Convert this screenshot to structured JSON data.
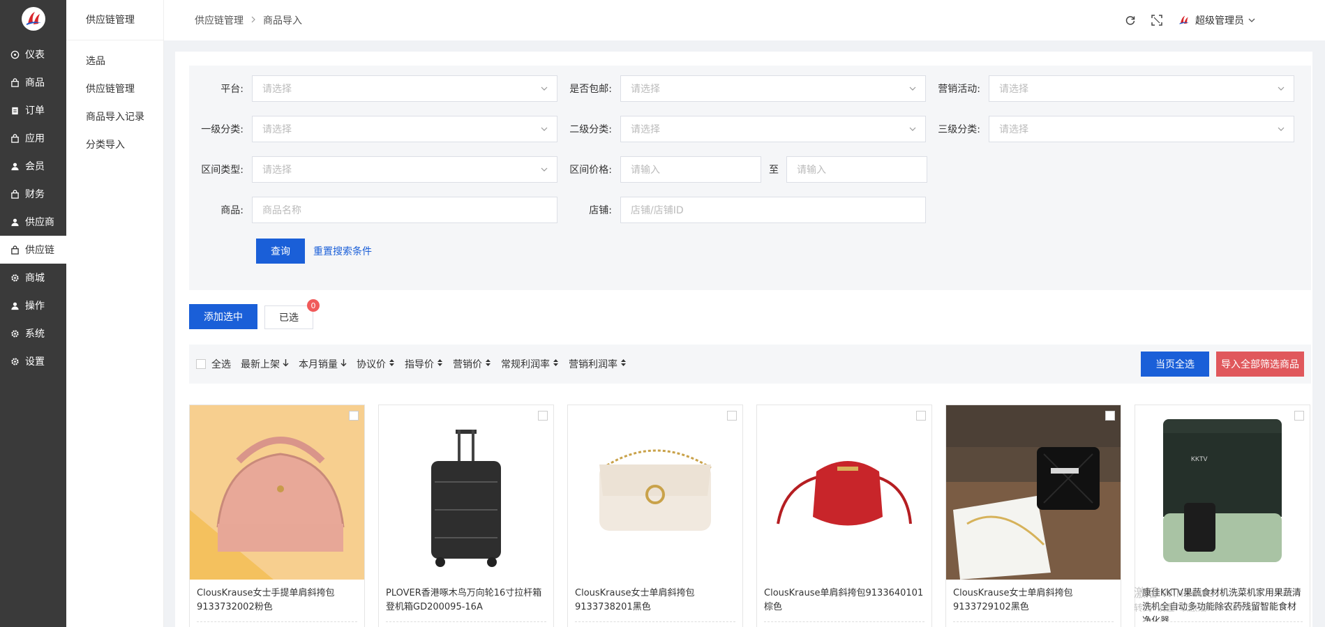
{
  "sidebar": {
    "items": [
      {
        "label": "仪表",
        "icon": "dashboard-icon"
      },
      {
        "label": "商品",
        "icon": "bag-icon"
      },
      {
        "label": "订单",
        "icon": "clipboard-icon"
      },
      {
        "label": "应用",
        "icon": "bag-icon"
      },
      {
        "label": "会员",
        "icon": "user-icon"
      },
      {
        "label": "财务",
        "icon": "bag-icon"
      },
      {
        "label": "供应商",
        "icon": "user-icon"
      },
      {
        "label": "供应链",
        "icon": "bag-icon"
      },
      {
        "label": "商城",
        "icon": "gear-icon"
      },
      {
        "label": "操作",
        "icon": "user-icon"
      },
      {
        "label": "系统",
        "icon": "gear-icon"
      },
      {
        "label": "设置",
        "icon": "gear-icon"
      }
    ],
    "active_index": 7
  },
  "subbar": {
    "title": "供应链管理",
    "items": [
      "选品",
      "供应链管理",
      "商品导入记录",
      "分类导入"
    ]
  },
  "header": {
    "breadcrumb": [
      "供应链管理",
      "商品导入"
    ],
    "user": "超级管理员"
  },
  "filters": {
    "platform": {
      "label": "平台:",
      "placeholder": "请选择"
    },
    "free_shipping": {
      "label": "是否包邮:",
      "placeholder": "请选择"
    },
    "marketing": {
      "label": "营销活动:",
      "placeholder": "请选择"
    },
    "cat1": {
      "label": "一级分类:",
      "placeholder": "请选择"
    },
    "cat2": {
      "label": "二级分类:",
      "placeholder": "请选择"
    },
    "cat3": {
      "label": "三级分类:",
      "placeholder": "请选择"
    },
    "range_type": {
      "label": "区间类型:",
      "placeholder": "请选择"
    },
    "range_price": {
      "label": "区间价格:",
      "from_placeholder": "请输入",
      "to": "至",
      "to_placeholder": "请输入"
    },
    "product": {
      "label": "商品:",
      "placeholder": "商品名称"
    },
    "shop": {
      "label": "店铺:",
      "placeholder": "店铺/店铺ID"
    },
    "query_button": "查询",
    "reset_link": "重置搜索条件"
  },
  "actions": {
    "add_selected": "添加选中",
    "selected": "已选",
    "selected_count": "0"
  },
  "sortbar": {
    "select_all": "全选",
    "sorts": [
      "最新上架",
      "本月销量",
      "协议价",
      "指导价",
      "营销价",
      "常规利润率",
      "营销利润率"
    ],
    "current_page_all": "当页全选",
    "import_all": "导入全部筛选商品"
  },
  "products": [
    {
      "name": "ClousKrause女士手提单肩斜挎包9133732002粉色"
    },
    {
      "name": "PLOVER香港啄木鸟万向轮16寸拉杆箱登机箱GD200095-16A"
    },
    {
      "name": "ClousKrause女士单肩斜挎包9133738201黑色"
    },
    {
      "name": "ClousKrause单肩斜挎包9133640101棕色"
    },
    {
      "name": "ClousKrause女士单肩斜挎包9133729102黑色"
    },
    {
      "name": "康佳KKTV果蔬食材机洗菜机家用果蔬清洗机全自动多功能除农药残留智能食材净化器",
      "brand_text": "KKTV"
    }
  ],
  "watermark": [
    "激活 Windows",
    "转到“设置”以激活 Windows。"
  ],
  "colors": {
    "primary": "#1a5fd8",
    "danger": "#e0585c",
    "sidebar": "#3a3a3a",
    "badge": "#f05a5a"
  }
}
